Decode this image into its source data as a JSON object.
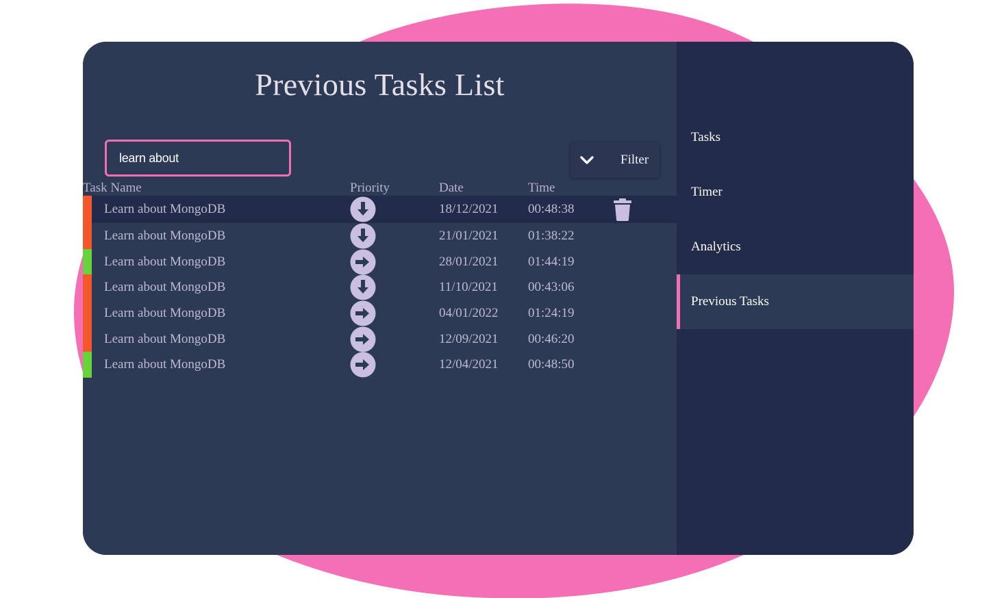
{
  "colors": {
    "background_blob": "#f56fb5",
    "panel": "#2c3a55",
    "sidebar": "#222b49",
    "accent": "#f26fb1",
    "priority_high": "#f4572b",
    "priority_low": "#66d43a",
    "icon_fill": "#c9bfe0"
  },
  "header": {
    "title": "Previous Tasks List"
  },
  "search": {
    "value": "learn about"
  },
  "filter": {
    "label": "Filter",
    "icon": "chevron-down-icon"
  },
  "table": {
    "columns": {
      "name": "Task Name",
      "priority": "Priority",
      "date": "Date",
      "time": "Time"
    },
    "rows": [
      {
        "name": "Learn about MongoDB",
        "priority_icon": "arrow-down-circle-icon",
        "color": "#f4572b",
        "date": "18/12/2021",
        "time": "00:48:38"
      },
      {
        "name": "Learn about MongoDB",
        "priority_icon": "arrow-down-circle-icon",
        "color": "#f4572b",
        "date": "21/01/2021",
        "time": "01:38:22"
      },
      {
        "name": "Learn about MongoDB",
        "priority_icon": "arrow-right-circle-icon",
        "color": "#66d43a",
        "date": "28/01/2021",
        "time": "01:44:19"
      },
      {
        "name": "Learn about MongoDB",
        "priority_icon": "arrow-down-circle-icon",
        "color": "#f4572b",
        "date": "11/10/2021",
        "time": "00:43:06"
      },
      {
        "name": "Learn about MongoDB",
        "priority_icon": "arrow-right-circle-icon",
        "color": "#f4572b",
        "date": "04/01/2022",
        "time": "01:24:19"
      },
      {
        "name": "Learn about MongoDB",
        "priority_icon": "arrow-right-circle-icon",
        "color": "#f4572b",
        "date": "12/09/2021",
        "time": "00:46:20"
      },
      {
        "name": "Learn about MongoDB",
        "priority_icon": "arrow-right-circle-icon",
        "color": "#66d43a",
        "date": "12/04/2021",
        "time": "00:48:50"
      }
    ],
    "selected_row_action_icon": "trash-icon"
  },
  "sidebar": {
    "items": [
      {
        "label": "Tasks"
      },
      {
        "label": "Timer"
      },
      {
        "label": "Analytics"
      },
      {
        "label": "Previous Tasks",
        "active": true
      }
    ]
  }
}
